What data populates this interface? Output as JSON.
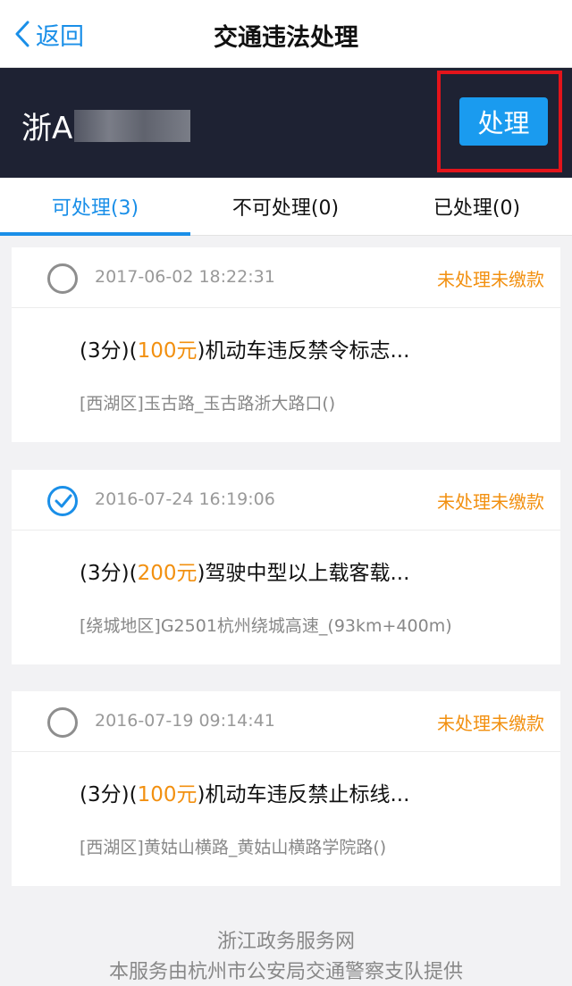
{
  "nav": {
    "back_label": "返回",
    "title": "交通违法处理"
  },
  "plate": {
    "prefix": "浙A"
  },
  "action": {
    "process_label": "处理"
  },
  "tabs": [
    {
      "label": "可处理(3)"
    },
    {
      "label": "不可处理(0)"
    },
    {
      "label": "已处理(0)"
    }
  ],
  "violations": [
    {
      "time": "2017-06-02 18:22:31",
      "status": "未处理未缴款",
      "points": "(3分)(",
      "fine": "100元",
      "desc": ")机动车违反禁令标志...",
      "location": "[西湖区]玉古路_玉古路浙大路口()",
      "checked": false
    },
    {
      "time": "2016-07-24 16:19:06",
      "status": "未处理未缴款",
      "points": "(3分)(",
      "fine": "200元",
      "desc": ")驾驶中型以上载客载...",
      "location": "[绕城地区]G2501杭州绕城高速_(93km+400m)",
      "checked": true
    },
    {
      "time": "2016-07-19 09:14:41",
      "status": "未处理未缴款",
      "points": "(3分)(",
      "fine": "100元",
      "desc": ")机动车违反禁止标线...",
      "location": "[西湖区]黄姑山横路_黄姑山横路学院路()",
      "checked": false
    }
  ],
  "footer": {
    "line1": "浙江政务服务网",
    "line2": "本服务由杭州市公安局交通警察支队提供"
  },
  "colors": {
    "accent": "#1a8fe8",
    "warning": "#f29010",
    "header_dark": "#1e2233",
    "highlight": "#e3141b"
  }
}
